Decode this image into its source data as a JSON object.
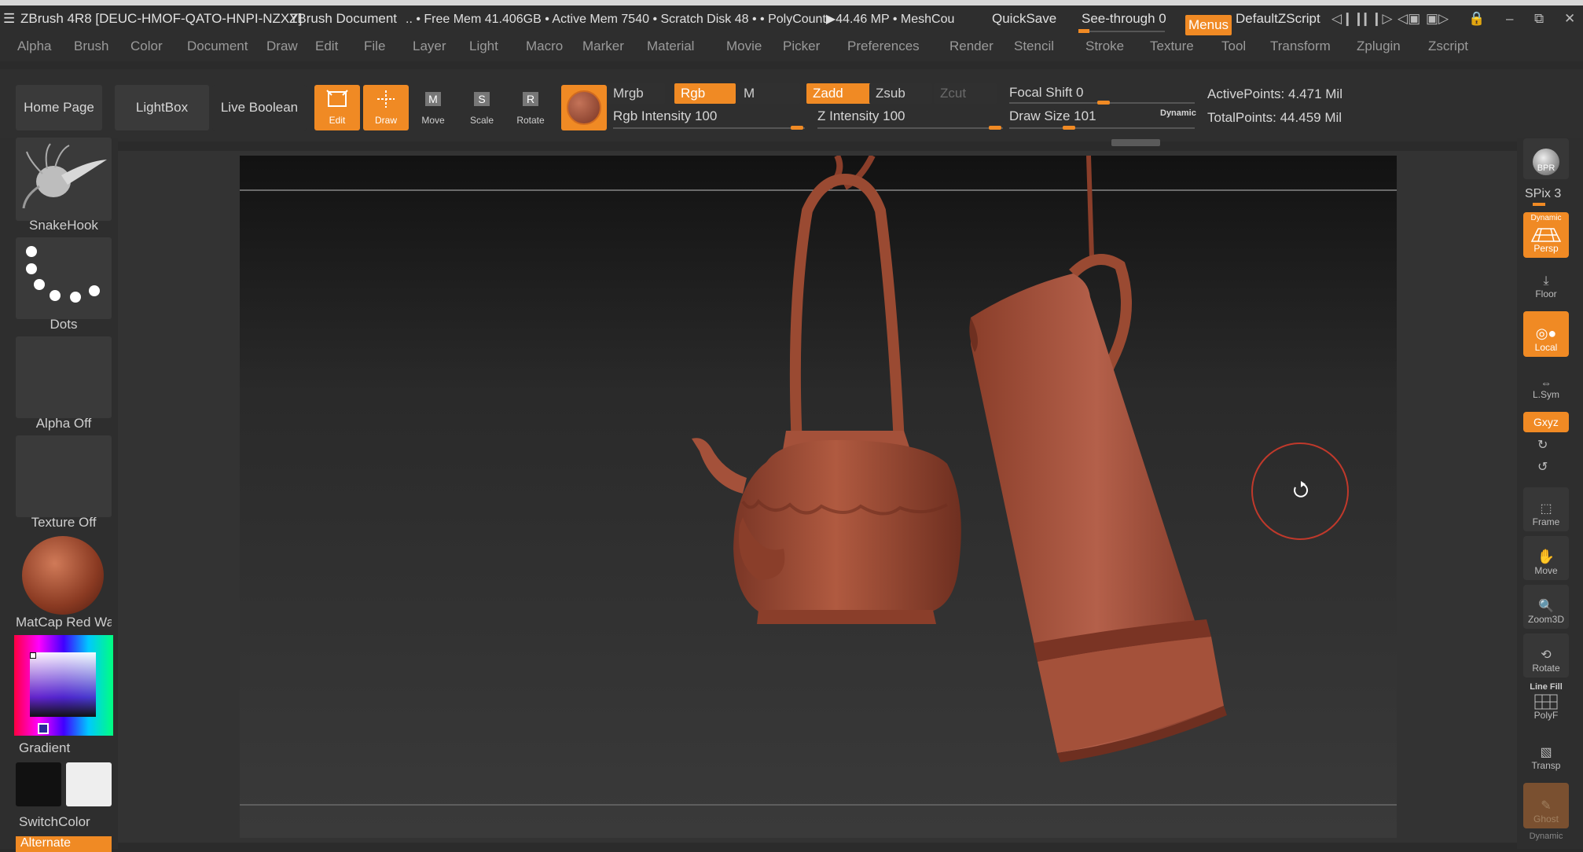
{
  "titlebar": {
    "app_title": "ZBrush 4R8 [DEUC-HMOF-QATO-HNPI-NZXY]",
    "document": "ZBrush Document",
    "stats": ".. • Free Mem 41.406GB • Active Mem 7540 • Scratch Disk 48 •  • PolyCount▶44.46 MP  • MeshCou",
    "quicksave": "QuickSave",
    "seethrough": "See-through  0",
    "menus": "Menus",
    "script": "DefaultZScript"
  },
  "menubar": {
    "items": [
      "Alpha",
      "Brush",
      "Color",
      "Document",
      "Draw",
      "Edit",
      "File",
      "Layer",
      "Light",
      "Macro",
      "Marker",
      "Material",
      "Movie",
      "Picker",
      "Preferences",
      "Render",
      "Stencil",
      "Stroke",
      "Texture",
      "Tool",
      "Transform",
      "Zplugin",
      "Zscript"
    ]
  },
  "shelf": {
    "home": "Home Page",
    "lightbox": "LightBox",
    "liveboolean": "Live Boolean",
    "tools": [
      {
        "label": "Edit",
        "on": true
      },
      {
        "label": "Draw",
        "on": true
      },
      {
        "label": "Move",
        "on": false
      },
      {
        "label": "Scale",
        "on": false
      },
      {
        "label": "Rotate",
        "on": false
      }
    ],
    "mrgb": "Mrgb",
    "rgb": "Rgb",
    "m": "M",
    "zadd": "Zadd",
    "zsub": "Zsub",
    "zcut": "Zcut",
    "rgb_intensity": "Rgb Intensity 100",
    "z_intensity": "Z Intensity 100",
    "focal_shift": "Focal Shift 0",
    "draw_size": "Draw Size 101",
    "dynamic": "Dynamic",
    "active_points": "ActivePoints: 4.471 Mil",
    "total_points": "TotalPoints: 44.459 Mil"
  },
  "lefttray": {
    "brush": "SnakeHook",
    "stroke": "Dots",
    "alpha": "Alpha Off",
    "texture": "Texture Off",
    "material": "MatCap Red Wax",
    "gradient": "Gradient",
    "switchcolor": "SwitchColor",
    "alternate": "Alternate"
  },
  "righttray": {
    "bpr": "BPR",
    "spix": "SPix 3",
    "dynamic": "Dynamic",
    "persp": "Persp",
    "floor": "Floor",
    "local": "Local",
    "lsym": "L.Sym",
    "xyz": "Gxyz",
    "frame": "Frame",
    "move": "Move",
    "zoom3d": "Zoom3D",
    "rotate": "Rotate",
    "linefill": "Line Fill",
    "polyf": "PolyF",
    "transp": "Transp",
    "ghost": "Ghost",
    "dynamic2": "Dynamic"
  },
  "colors": {
    "accent": "#f08a24",
    "clay": "#a4513a"
  }
}
